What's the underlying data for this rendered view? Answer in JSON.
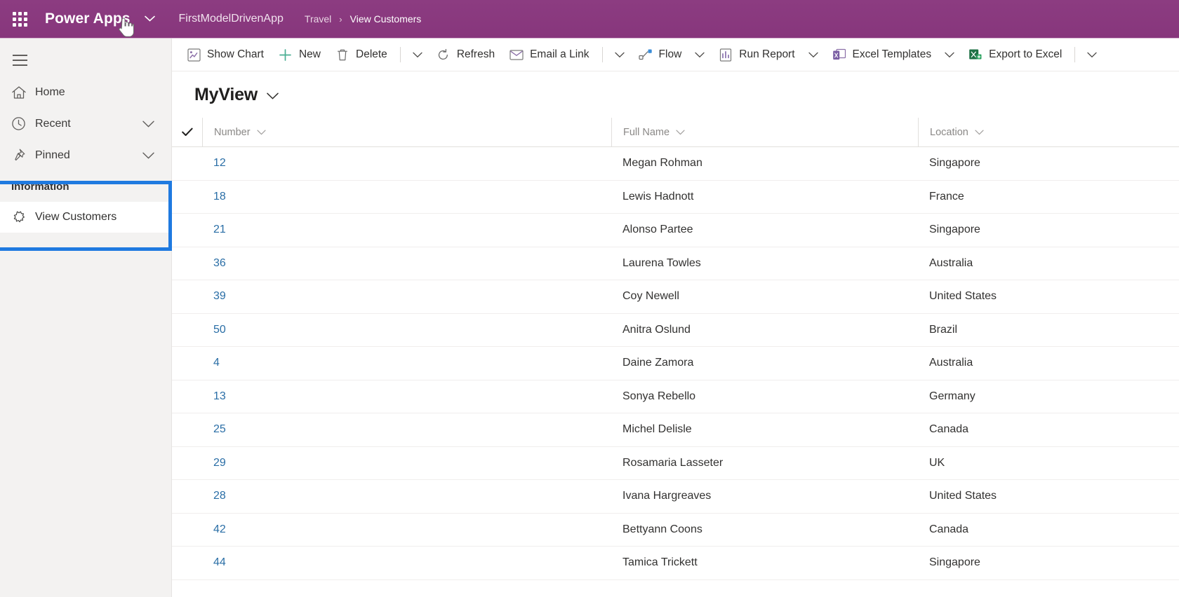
{
  "header": {
    "waffle_icon": "app-launcher-waffle-icon",
    "brand": "Power Apps",
    "brand_chevron_icon": "chevron-down-icon",
    "app_name": "FirstModelDrivenApp",
    "breadcrumb": {
      "parent": "Travel",
      "separator": "›",
      "current": "View Customers"
    },
    "cursor_icon": "hand-pointer-cursor",
    "bar_color": "#8a3a7f"
  },
  "sidebar": {
    "hamburger_icon": "hamburger-menu-icon",
    "items": [
      {
        "label": "Home",
        "icon": "home-icon",
        "chevron": false
      },
      {
        "label": "Recent",
        "icon": "clock-icon",
        "chevron": true
      },
      {
        "label": "Pinned",
        "icon": "pin-icon",
        "chevron": true
      }
    ],
    "group": {
      "header": "Information",
      "items": [
        {
          "label": "View Customers",
          "icon": "entity-puzzle-icon"
        }
      ]
    },
    "highlight_color": "#1f7ae0"
  },
  "commandbar": {
    "items": [
      {
        "label": "Show Chart",
        "icon": "chart-icon",
        "type": "button"
      },
      {
        "label": "New",
        "icon": "plus-icon",
        "type": "button"
      },
      {
        "label": "Delete",
        "icon": "trash-icon",
        "type": "button"
      },
      {
        "label": "",
        "icon": "separator",
        "type": "separator"
      },
      {
        "label": "",
        "icon": "chevron-down-icon",
        "type": "overflow"
      },
      {
        "label": "Refresh",
        "icon": "refresh-icon",
        "type": "button"
      },
      {
        "label": "Email a Link",
        "icon": "email-icon",
        "type": "button"
      },
      {
        "label": "",
        "icon": "separator",
        "type": "separator"
      },
      {
        "label": "",
        "icon": "chevron-down-icon",
        "type": "overflow"
      },
      {
        "label": "Flow",
        "icon": "flow-icon",
        "type": "button"
      },
      {
        "label": "",
        "icon": "chevron-down-icon",
        "type": "overflow"
      },
      {
        "label": "Run Report",
        "icon": "report-icon",
        "type": "button"
      },
      {
        "label": "",
        "icon": "chevron-down-icon",
        "type": "overflow"
      },
      {
        "label": "Excel Templates",
        "icon": "excel-template-icon",
        "type": "button"
      },
      {
        "label": "",
        "icon": "chevron-down-icon",
        "type": "overflow"
      },
      {
        "label": "Export to Excel",
        "icon": "excel-icon",
        "type": "button"
      },
      {
        "label": "",
        "icon": "separator",
        "type": "separator"
      },
      {
        "label": "",
        "icon": "chevron-down-icon",
        "type": "overflow"
      }
    ]
  },
  "view": {
    "name": "MyView",
    "chevron_icon": "chevron-down-icon"
  },
  "grid": {
    "select_all_icon": "checkmark-icon",
    "columns": [
      {
        "label": "Number",
        "chevron_icon": "chevron-down-icon"
      },
      {
        "label": "Full Name",
        "chevron_icon": "chevron-down-icon"
      },
      {
        "label": "Location",
        "chevron_icon": "chevron-down-icon"
      }
    ],
    "rows": [
      {
        "number": "12",
        "full_name": "Megan Rohman",
        "location": "Singapore"
      },
      {
        "number": "18",
        "full_name": "Lewis Hadnott",
        "location": "France"
      },
      {
        "number": "21",
        "full_name": "Alonso Partee",
        "location": "Singapore"
      },
      {
        "number": "36",
        "full_name": "Laurena Towles",
        "location": "Australia"
      },
      {
        "number": "39",
        "full_name": "Coy Newell",
        "location": "United States"
      },
      {
        "number": "50",
        "full_name": "Anitra Oslund",
        "location": "Brazil"
      },
      {
        "number": "4",
        "full_name": "Daine Zamora",
        "location": "Australia"
      },
      {
        "number": "13",
        "full_name": "Sonya Rebello",
        "location": "Germany"
      },
      {
        "number": "25",
        "full_name": "Michel Delisle",
        "location": "Canada"
      },
      {
        "number": "29",
        "full_name": "Rosamaria Lasseter",
        "location": "UK"
      },
      {
        "number": "28",
        "full_name": "Ivana Hargreaves",
        "location": "United States"
      },
      {
        "number": "42",
        "full_name": "Bettyann Coons",
        "location": "Canada"
      },
      {
        "number": "44",
        "full_name": "Tamica Trickett",
        "location": "Singapore"
      }
    ],
    "link_color": "#2a6ea6"
  }
}
